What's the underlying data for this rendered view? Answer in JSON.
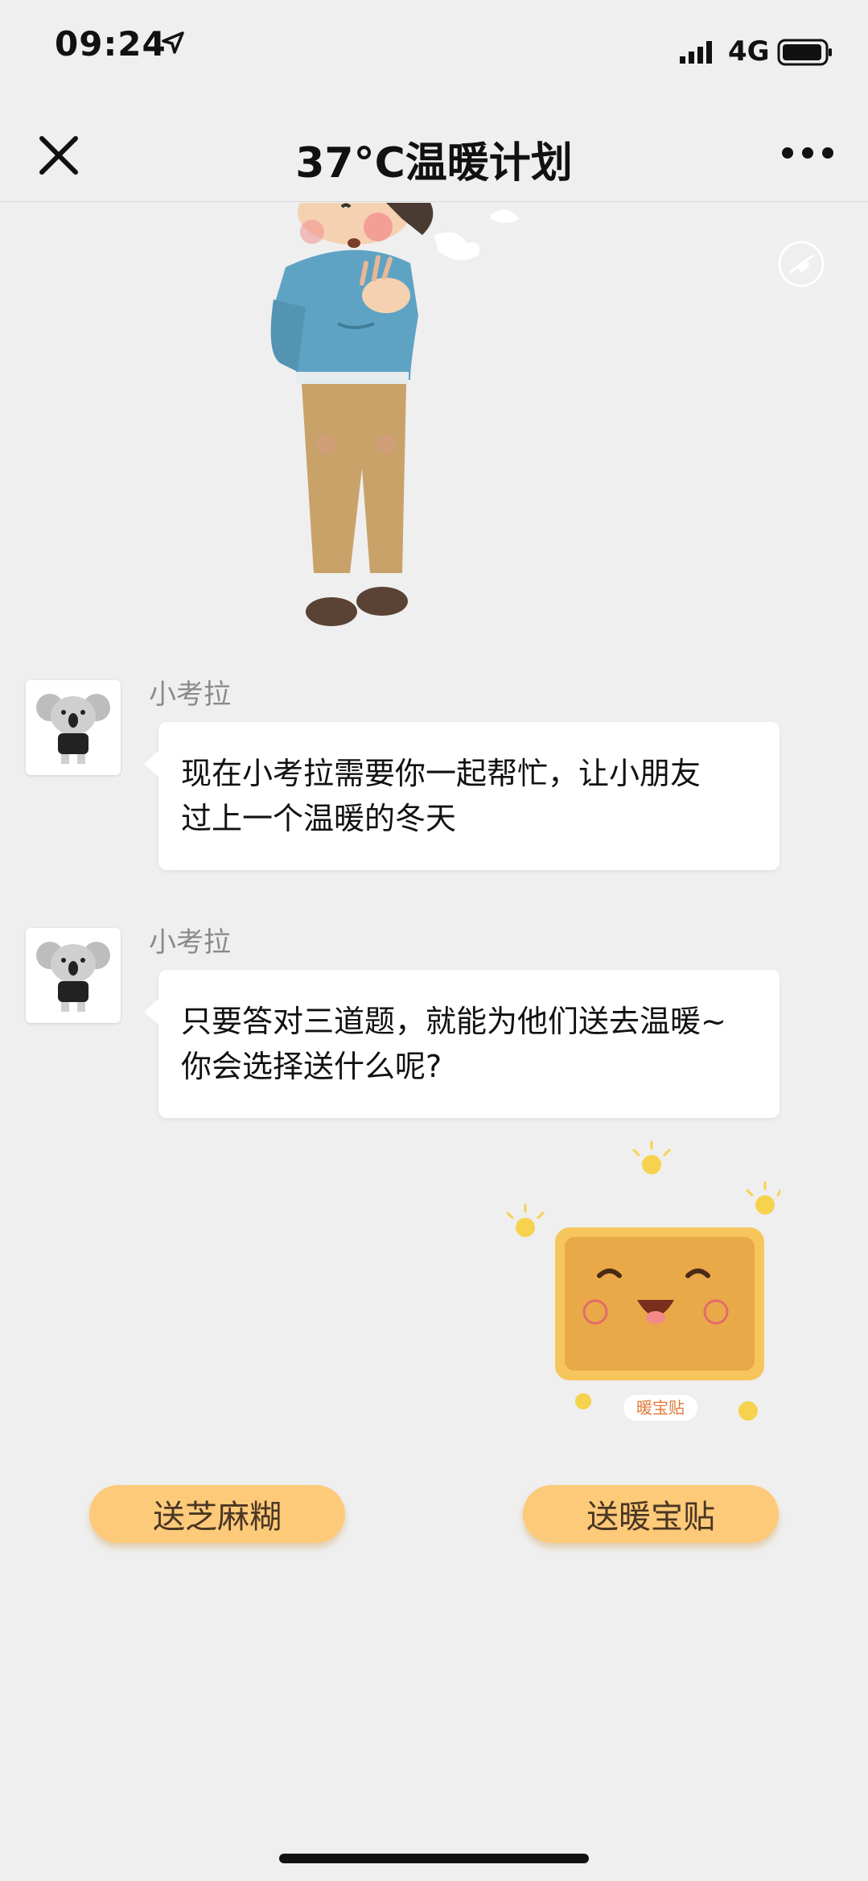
{
  "status_bar": {
    "time": "09:24",
    "network": "4G"
  },
  "nav": {
    "title": "37°C温暖计划"
  },
  "messages": [
    {
      "sender": "小考拉",
      "text_line1": "现在小考拉需要你一起帮忙，让小朋友",
      "text_line2": "过上一个温暖的冬天"
    },
    {
      "sender": "小考拉",
      "text_line1": "只要答对三道题，就能为他们送去温暖~",
      "text_line2": "你会选择送什么呢?"
    }
  ],
  "sticker": {
    "label": "暖宝贴"
  },
  "choices": {
    "left": "送芝麻糊",
    "right": "送暖宝贴"
  },
  "colors": {
    "background": "#efefef",
    "button": "#fdca7a",
    "bubble": "#ffffff"
  }
}
